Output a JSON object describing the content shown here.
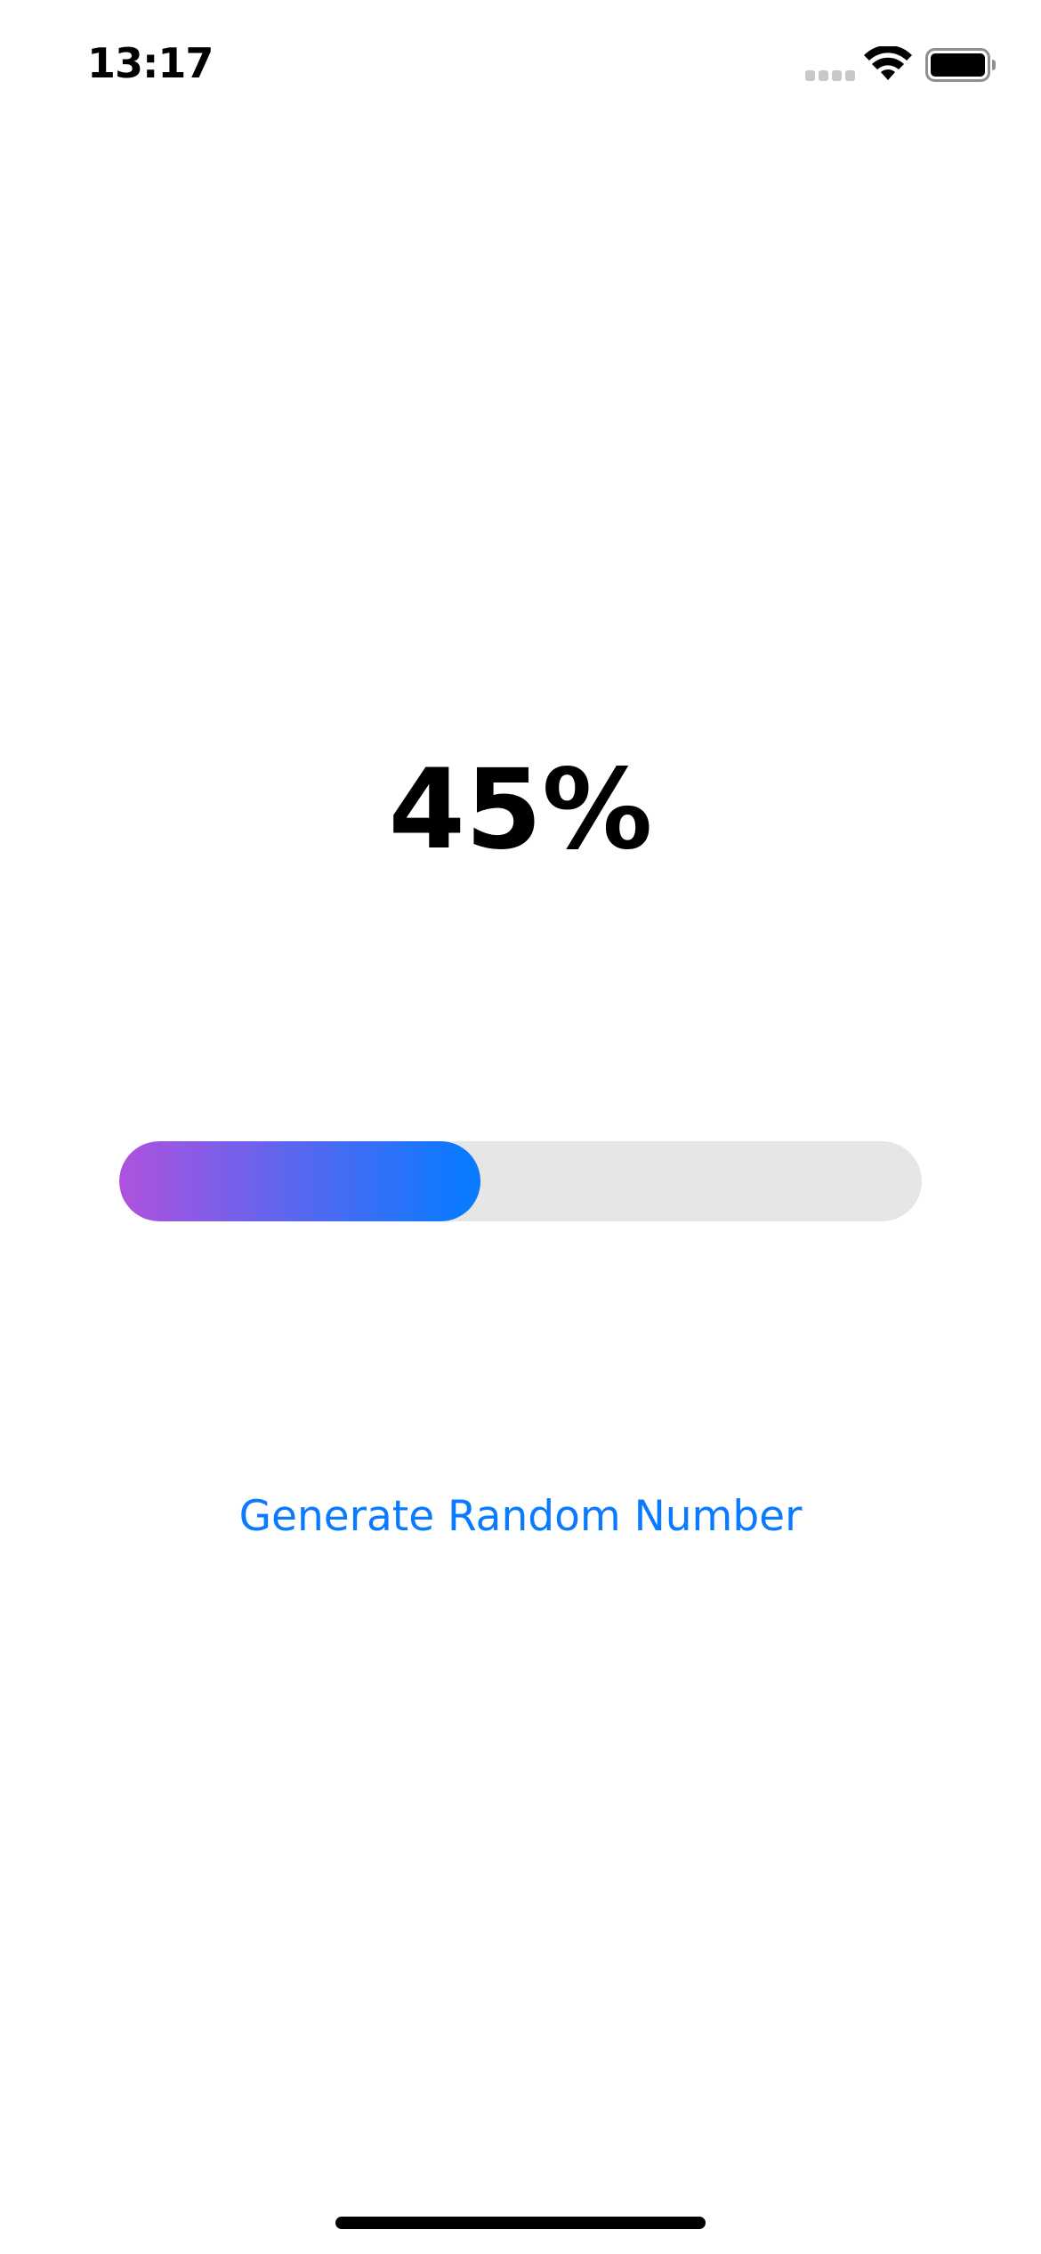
{
  "status_bar": {
    "time": "13:17",
    "icons": [
      "signal-icon",
      "wifi-icon",
      "battery-icon"
    ]
  },
  "progress": {
    "label": "45%",
    "value": 0.45,
    "gradient_start": "#af52de",
    "gradient_end": "#0a7aff",
    "track_color": "#e6e6e6"
  },
  "actions": {
    "generate_label": "Generate Random Number",
    "accent_color": "#0a7aff"
  }
}
